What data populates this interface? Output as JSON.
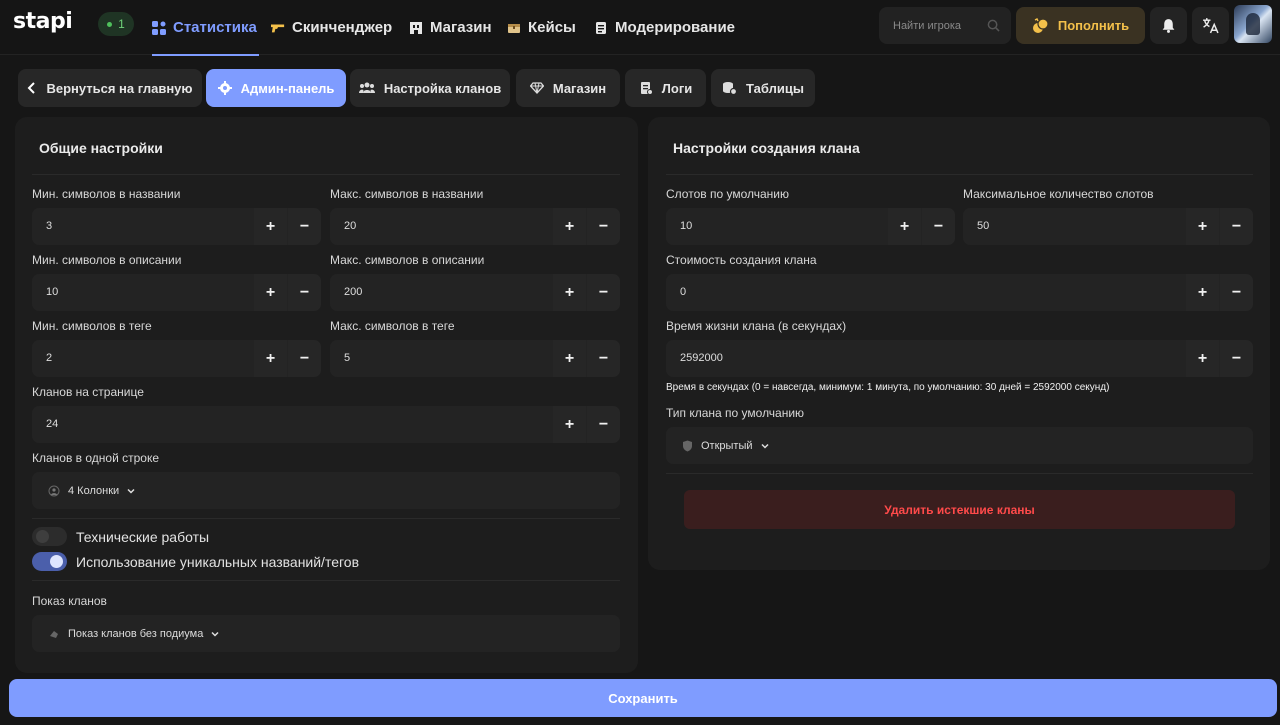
{
  "brand": {
    "logo": "stapi",
    "online_count": "1"
  },
  "nav": {
    "items": [
      {
        "label": "Статистика",
        "icon": "stats-icon",
        "active": true
      },
      {
        "label": "Скинченджер",
        "icon": "gun-icon"
      },
      {
        "label": "Магазин",
        "icon": "shop-icon"
      },
      {
        "label": "Кейсы",
        "icon": "case-icon"
      },
      {
        "label": "Модерирование",
        "icon": "moderation-icon"
      }
    ],
    "search_placeholder": "Найти игрока",
    "topup_label": "Пополнить"
  },
  "tabs": [
    {
      "label": "Вернуться на главную",
      "icon": "chevron-left-icon"
    },
    {
      "label": "Админ-панель",
      "icon": "gear-icon",
      "active": true
    },
    {
      "label": "Настройка кланов",
      "icon": "users-icon"
    },
    {
      "label": "Магазин",
      "icon": "diamond-icon"
    },
    {
      "label": "Логи",
      "icon": "logs-icon"
    },
    {
      "label": "Таблицы",
      "icon": "table-icon"
    }
  ],
  "general": {
    "title": "Общие настройки",
    "fields": [
      {
        "label": "Мин. символов в названии",
        "value": "3"
      },
      {
        "label": "Макс. символов в названии",
        "value": "20"
      },
      {
        "label": "Мин. символов в описании",
        "value": "10"
      },
      {
        "label": "Макс. символов в описании",
        "value": "200"
      },
      {
        "label": "Мин. символов в теге",
        "value": "2"
      },
      {
        "label": "Макс. символов в теге",
        "value": "5"
      },
      {
        "label": "Кланов на странице",
        "value": "24"
      }
    ],
    "row_label": "Кланов в одной строке",
    "row_value": "4 Колонки",
    "maintenance_label": "Технические работы",
    "maintenance_on": false,
    "unique_label": "Использование уникальных названий/тегов",
    "unique_on": true,
    "display_label": "Показ кланов",
    "display_value": "Показ кланов без подиума"
  },
  "creation": {
    "title": "Настройки создания клана",
    "fields": [
      {
        "label": "Слотов по умолчанию",
        "value": "10"
      },
      {
        "label": "Максимальное количество слотов",
        "value": "50"
      },
      {
        "label": "Стоимость создания клана",
        "value": "0"
      },
      {
        "label": "Время жизни клана (в секундах)",
        "value": "2592000"
      }
    ],
    "hint": "Время в секундах (0 = навсегда, минимум: 1 минута, по умолчанию: 30 дней = 2592000 секунд)",
    "type_label": "Тип клана по умолчанию",
    "type_value": "Открытый",
    "delete_label": "Удалить истекшие кланы"
  },
  "stepper": {
    "plus": "+",
    "minus": "−"
  },
  "save_label": "Сохранить",
  "colors": {
    "accent": "#7f9cff",
    "gold": "#f3c04a",
    "danger": "#ff4a4a",
    "online": "#4fc05c"
  }
}
